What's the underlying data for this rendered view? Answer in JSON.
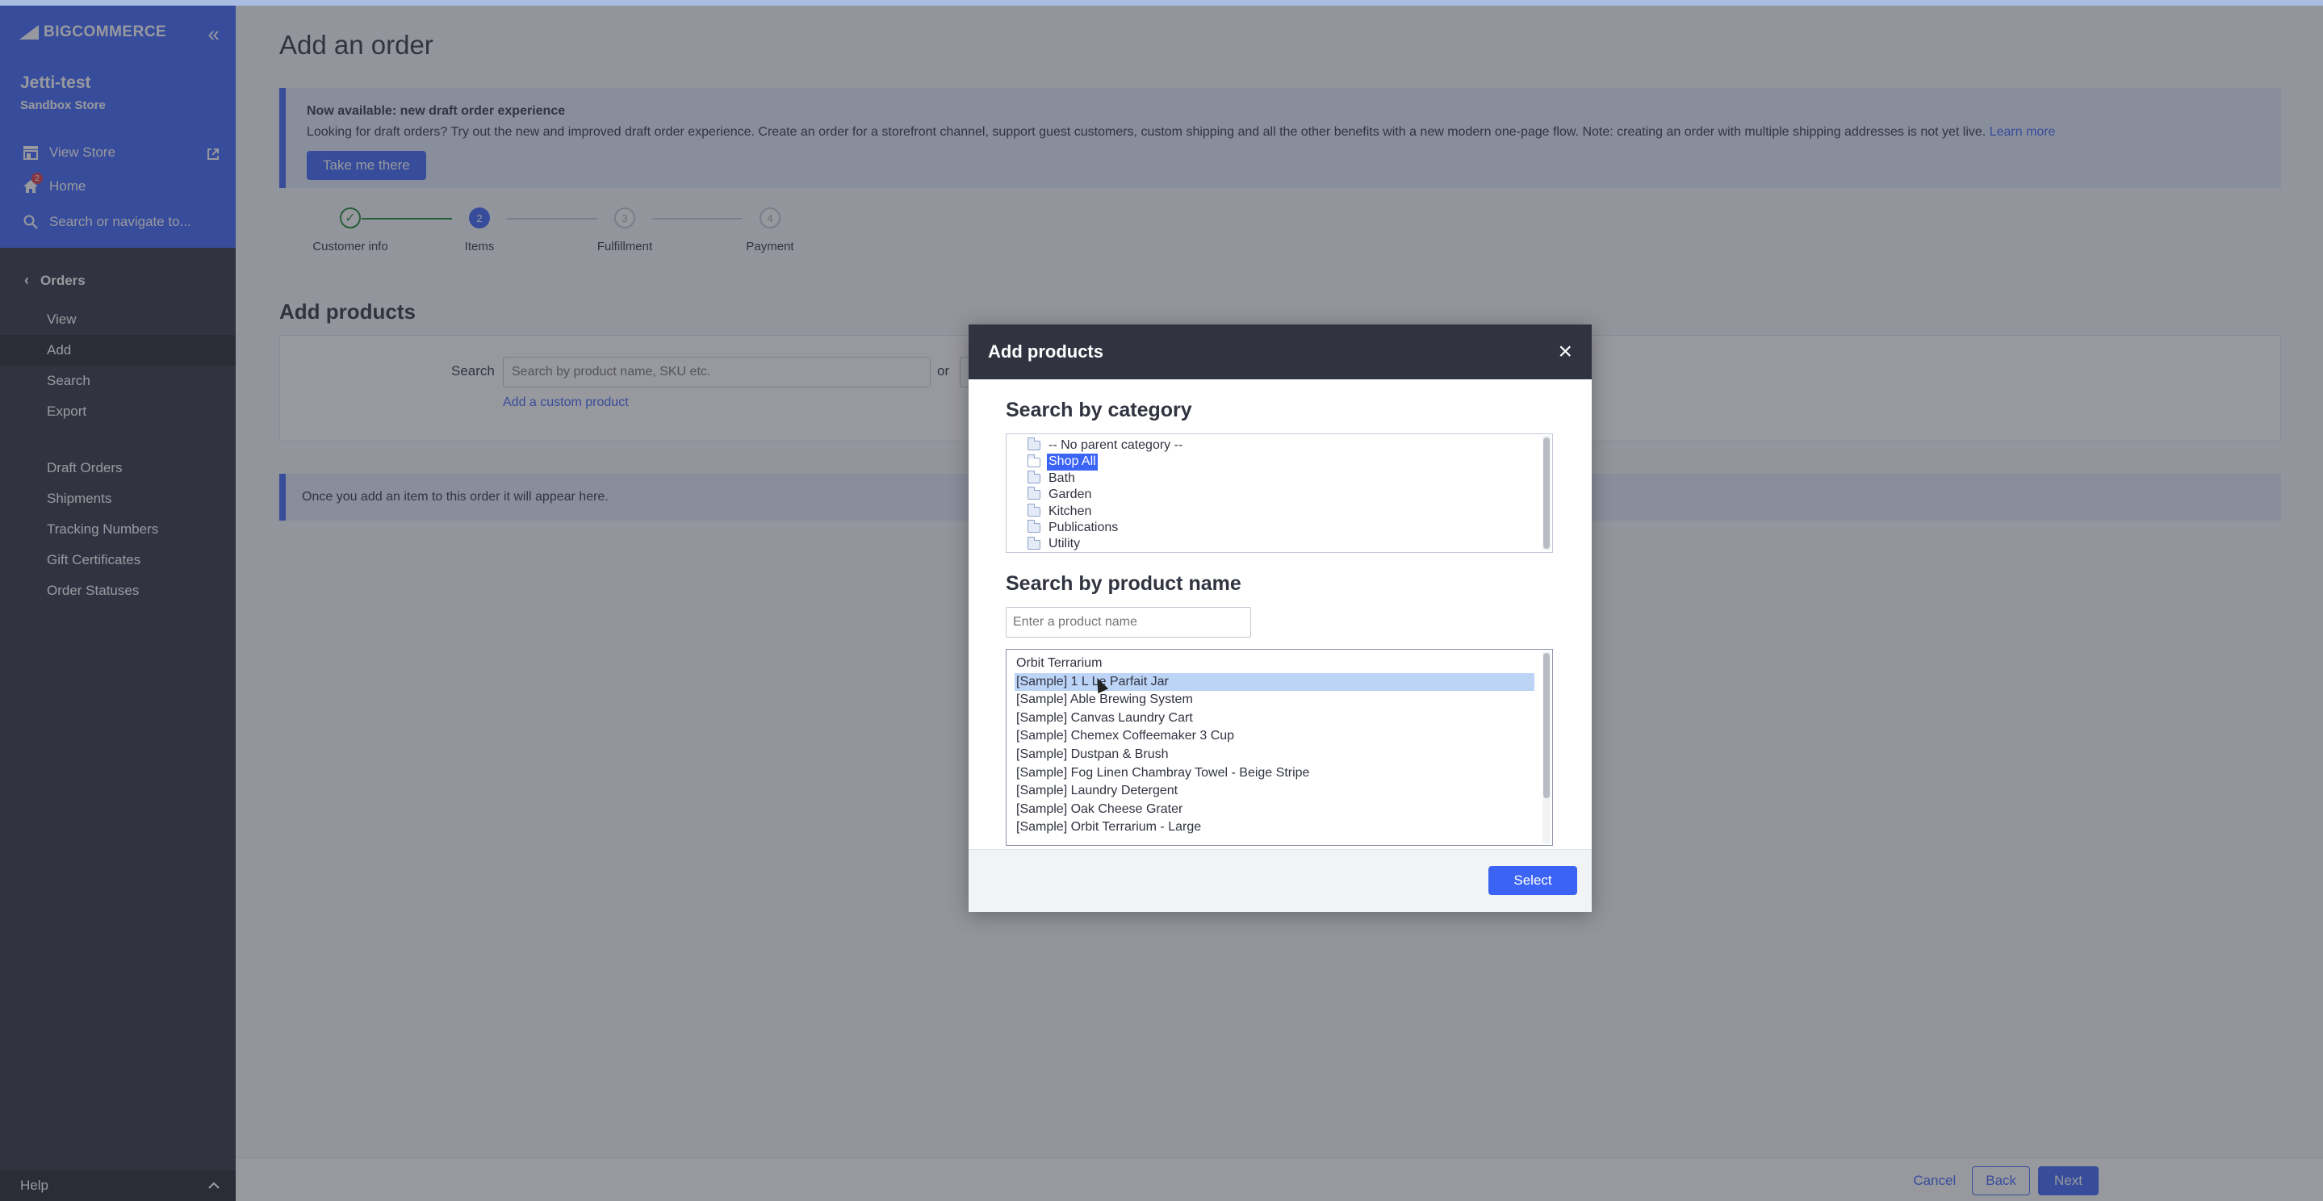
{
  "sidebar": {
    "logo_text": "BIGCOMMERCE",
    "collapse_icon": "double-chevron-left-icon",
    "store_name": "Jetti-test",
    "store_sub": "Sandbox Store",
    "view_store": "View Store",
    "home": "Home",
    "home_badge": "2",
    "search_placeholder": "Search or navigate to...",
    "section": "Orders",
    "nav_primary": [
      "View",
      "Add",
      "Search",
      "Export"
    ],
    "nav_secondary": [
      "Draft Orders",
      "Shipments",
      "Tracking Numbers",
      "Gift Certificates",
      "Order Statuses"
    ],
    "active": "Add",
    "help": "Help"
  },
  "page": {
    "title": "Add an order",
    "notice": {
      "title": "Now available: new draft order experience",
      "body": "Looking for draft orders? Try out the new and improved draft order experience. Create an order for a storefront channel, support guest customers, custom shipping and all the other benefits with a new modern one-page flow. Note: creating an order with multiple shipping addresses is not yet live.",
      "link": "Learn more",
      "button": "Take me there"
    },
    "steps": [
      {
        "num": "",
        "label": "Customer info",
        "state": "done"
      },
      {
        "num": "2",
        "label": "Items",
        "state": "current"
      },
      {
        "num": "3",
        "label": "Fulfillment",
        "state": "todo"
      },
      {
        "num": "4",
        "label": "Payment",
        "state": "todo"
      }
    ],
    "add_products_title": "Add products",
    "search_label": "Search",
    "search_placeholder": "Search by product name, SKU etc.",
    "or": "or",
    "custom_product_link": "Add a custom product",
    "empty_message": "Once you add an item to this order it will appear here.",
    "footer": {
      "cancel": "Cancel",
      "back": "Back",
      "next": "Next"
    }
  },
  "modal": {
    "title": "Add products",
    "category_heading": "Search by category",
    "categories": [
      "-- No parent category --",
      "Shop All",
      "Bath",
      "Garden",
      "Kitchen",
      "Publications",
      "Utility"
    ],
    "selected_category": "Shop All",
    "product_heading": "Search by product name",
    "product_placeholder": "Enter a product name",
    "products": [
      "Orbit Terrarium",
      "[Sample] 1 L Le Parfait Jar",
      "[Sample] Able Brewing System",
      "[Sample] Canvas Laundry Cart",
      "[Sample] Chemex Coffeemaker 3 Cup",
      "[Sample] Dustpan & Brush",
      "[Sample] Fog Linen Chambray Towel - Beige Stripe",
      "[Sample] Laundry Detergent",
      "[Sample] Oak Cheese Grater",
      "[Sample] Orbit Terrarium - Large"
    ],
    "selected_product": "[Sample] 1 L Le Parfait Jar",
    "select_button": "Select"
  }
}
